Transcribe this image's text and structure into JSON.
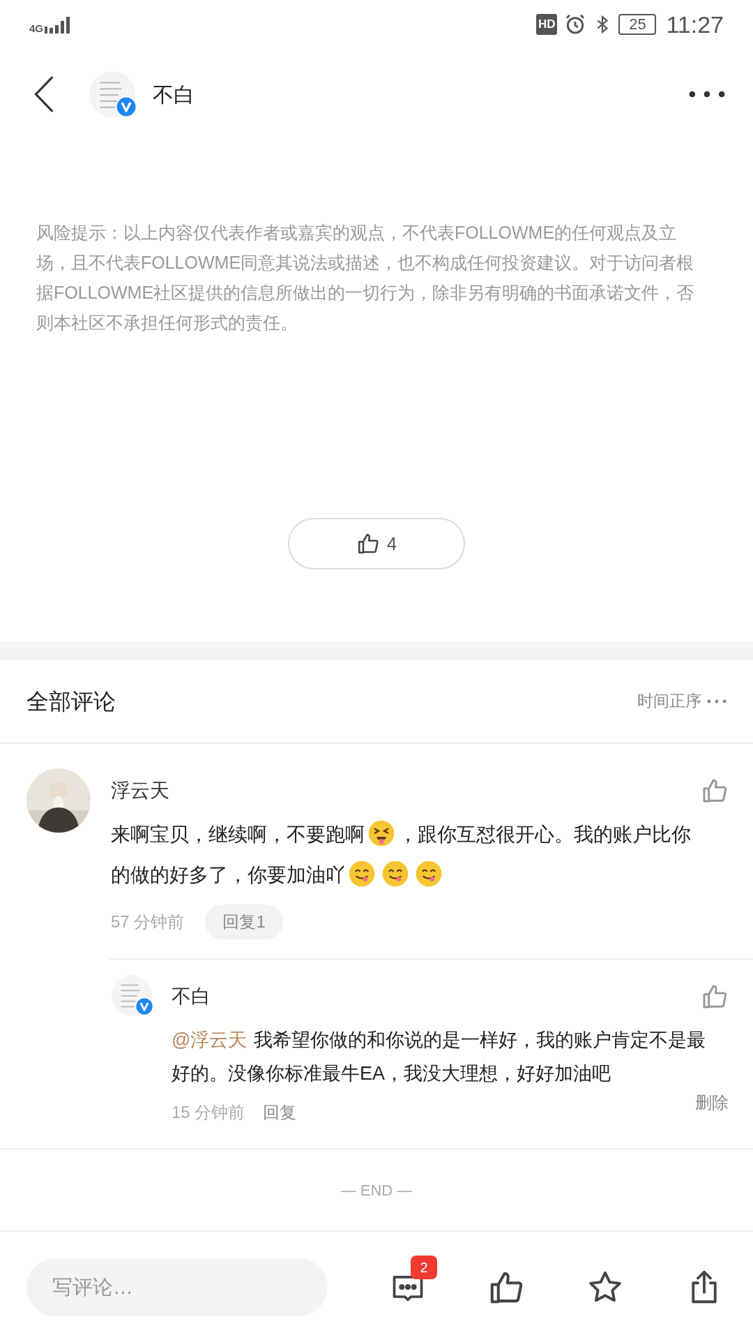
{
  "status_bar": {
    "network": "4G",
    "hd": "HD",
    "battery": "25",
    "time": "11:27"
  },
  "header": {
    "author": "不白"
  },
  "disclaimer": "风险提示：以上内容仅代表作者或嘉宾的观点，不代表FOLLOWME的任何观点及立场，且不代表FOLLOWME同意其说法或描述，也不构成任何投资建议。对于访问者根据FOLLOWME社区提供的信息所做出的一切行为，除非另有明确的书面承诺文件，否则本社区不承担任何形式的责任。",
  "like_count": "4",
  "comments_header": {
    "title": "全部评论",
    "sort": "时间正序"
  },
  "comments": [
    {
      "author": "浮云天",
      "time": "57 分钟前",
      "reply_label": "回复1",
      "segments": [
        {
          "kind": "text",
          "text": "来啊宝贝，继续啊，不要跑啊"
        },
        {
          "kind": "squint"
        },
        {
          "kind": "text",
          "text": "，跟你互怼很开心。我的账户比你的做的好多了，你要加油吖"
        },
        {
          "kind": "yum"
        },
        {
          "kind": "yum"
        },
        {
          "kind": "yum"
        }
      ],
      "replies": [
        {
          "author": "不白",
          "time": "15 分钟前",
          "reply_label": "回复",
          "delete_label": "删除",
          "segments": [
            {
              "kind": "mention",
              "text": "@浮云天"
            },
            {
              "kind": "text",
              "text": "我希望你做的和你说的是一样好，我的账户肯定不是最好的。没像你标准最牛EA，我没大理想，好好加油吧"
            }
          ]
        }
      ]
    }
  ],
  "end_label": "— END —",
  "bottom_bar": {
    "placeholder": "写评论…",
    "comment_count": "2"
  }
}
